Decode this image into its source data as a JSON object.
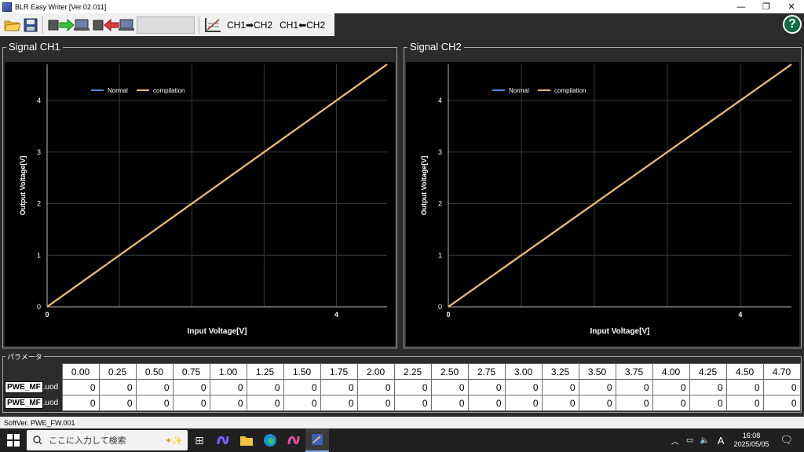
{
  "window": {
    "title": "BLR Easy Writer [Ver.02.011]"
  },
  "toolbar": {
    "ch1_to_ch2": "CH1➡CH2",
    "ch2_to_ch1": "CH1⬅CH2"
  },
  "panels": [
    {
      "title": "Signal CH1"
    },
    {
      "title": "Signal CH2"
    }
  ],
  "chart_data": [
    {
      "type": "line",
      "title": "Signal CH1",
      "xlabel": "Input Voltage[V]",
      "ylabel": "Output Voltage[V]",
      "xlim": [
        0,
        4.7
      ],
      "ylim": [
        0,
        4.7
      ],
      "x_ticks": [
        0,
        4
      ],
      "y_ticks": [
        0,
        1,
        2,
        3,
        4
      ],
      "grid": true,
      "legend": "top-left",
      "series": [
        {
          "name": "Normal",
          "color": "#4a86e8",
          "x": [
            0,
            4.7
          ],
          "y": [
            0,
            4.7
          ]
        },
        {
          "name": "compilation",
          "color": "#f2b96a",
          "x": [
            0,
            4.7
          ],
          "y": [
            0,
            4.7
          ]
        }
      ]
    },
    {
      "type": "line",
      "title": "Signal CH2",
      "xlabel": "Input Voltage[V]",
      "ylabel": "Output Voltage[V]",
      "xlim": [
        0,
        4.7
      ],
      "ylim": [
        0,
        4.7
      ],
      "x_ticks": [
        0,
        4
      ],
      "y_ticks": [
        0,
        1,
        2,
        3,
        4
      ],
      "grid": true,
      "legend": "top-left",
      "series": [
        {
          "name": "Normal",
          "color": "#4a86e8",
          "x": [
            0,
            4.7
          ],
          "y": [
            0,
            4.7
          ]
        },
        {
          "name": "compilation",
          "color": "#f2b96a",
          "x": [
            0,
            4.7
          ],
          "y": [
            0,
            4.7
          ]
        }
      ]
    }
  ],
  "params": {
    "title": "パラメータ",
    "headers": [
      "0.00",
      "0.25",
      "0.50",
      "0.75",
      "1.00",
      "1.25",
      "1.50",
      "1.75",
      "2.00",
      "2.25",
      "2.50",
      "2.75",
      "3.00",
      "3.25",
      "3.50",
      "3.75",
      "4.00",
      "4.25",
      "4.50",
      "4.70"
    ],
    "rows": [
      {
        "label": "PWE_MF",
        "suffix": ".uod",
        "values": [
          "0",
          "0",
          "0",
          "0",
          "0",
          "0",
          "0",
          "0",
          "0",
          "0",
          "0",
          "0",
          "0",
          "0",
          "0",
          "0",
          "0",
          "0",
          "0",
          "0"
        ]
      },
      {
        "label": "PWE_MF",
        "suffix": ".uod",
        "values": [
          "0",
          "0",
          "0",
          "0",
          "0",
          "0",
          "0",
          "0",
          "0",
          "0",
          "0",
          "0",
          "0",
          "0",
          "0",
          "0",
          "0",
          "0",
          "0",
          "0"
        ]
      }
    ]
  },
  "status": {
    "text": "SoftVer. PWE_FW.001"
  },
  "taskbar": {
    "search_placeholder": "ここに入力して検索",
    "ime": "A",
    "time": "16:08",
    "date": "2025/05/05"
  },
  "colors": {
    "accent": "#0e6b46",
    "line": "#f2b96a",
    "normal": "#4a86e8"
  }
}
